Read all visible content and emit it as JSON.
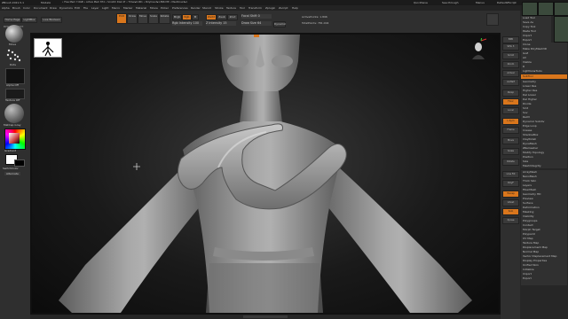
{
  "titlebar": {
    "app_title": "ZBrush 2021.5.1",
    "doc": "ModelA",
    "stats": "• Free Mem 7.6GB • Active Mem 874 • Scratch Disk 47 • Timer▸0.001 • PolyCount▸1.896 MP • MeshCount▸1",
    "quicksave": "QuickSave",
    "seethrough": "See-through",
    "menus": "Menus",
    "default_script": "DefaultZScript"
  },
  "menubar": {
    "items": [
      "Alpha",
      "Brush",
      "Color",
      "Document",
      "Draw",
      "Dynamics",
      "Edit",
      "File",
      "Layer",
      "Light",
      "Macro",
      "Marker",
      "Material",
      "Movie",
      "Picker",
      "Preferences",
      "Render",
      "Stencil",
      "Stroke",
      "Texture",
      "Tool",
      "Transform",
      "Zplugin",
      "Zscript",
      "Help"
    ]
  },
  "shelf": {
    "home_page": "Home Page",
    "lightbox": "LightBox",
    "live_boolean": "Live Boolean",
    "edit": "Edit",
    "draw": "Draw",
    "move": "Move",
    "scale": "Scale",
    "rotate": "Rotate",
    "mrgb": "Mrgb",
    "rgb": "Rgb",
    "m": "M",
    "zadd": "Zadd",
    "zsub": "Zsub",
    "zcut": "Zcut",
    "rgb_intensity": "Rgb Intensity 100",
    "z_intensity": "Z Intensity 15",
    "focal_shift": "Focal Shift 0",
    "draw_size": "Draw Size 64",
    "dynamic": "Dynamic",
    "active_points": "ActivePoints: 1.896",
    "total_points": "TotalPoints: 781.004",
    "bpr_hint": "BPR ZBR NOTE"
  },
  "left_shelf": {
    "brush_label": "Move",
    "stroke_label": "Dots",
    "alpha_label": "Alpha Off",
    "texture_label": "Texture Off",
    "material_label": "MatCap Gray",
    "gradient_label": "Gradient",
    "switch_color": "SwitchColor",
    "alternate": "Alternate"
  },
  "right_shelf": {
    "buttons": [
      "BPR",
      "SPix 3",
      "Scroll",
      "Zoom",
      "Actual",
      "AAHalf",
      "Persp",
      "Floor",
      "Local",
      "L.Sym",
      "Frame",
      "Move",
      "Scale",
      "Rotate",
      "Line Fill",
      "PolyF",
      "Transp",
      "Ghost",
      "Solo",
      "Xpose"
    ]
  },
  "tray": {
    "top": "Tool",
    "rows": [
      "Load Tool",
      "Save As",
      "Copy Tool",
      "Paste Tool",
      "Import",
      "Export",
      "Clone",
      "Make PolyMesh3D",
      "GoZ",
      "All",
      "Visible",
      "R",
      "Lightbox▸Tools",
      "SubTool",
      "Geometry",
      "Lower Res",
      "Higher Res",
      "Del Lower",
      "Del Higher",
      "Divide",
      "Smt",
      "Suv",
      "ReUV",
      "Dynamic Subdiv",
      "Edge Loop",
      "Crease",
      "ShadowBox",
      "ClayPolish",
      "DynaMesh",
      "ZRemesher",
      "Modify Topology",
      "Position",
      "Size",
      "MeshIntegrity",
      "ArrayMesh",
      "NanoMesh",
      "Thick Skin",
      "Layers",
      "FiberMesh",
      "Geometry HD",
      "Preview",
      "Surface",
      "Deformation",
      "Masking",
      "Visibility",
      "Polygroups",
      "Contact",
      "Morph Target",
      "Polypaint",
      "UV Map",
      "Texture Map",
      "Displacement Map",
      "Normal Map",
      "Vector Displacement Map",
      "Display Properties",
      "Unified Skin",
      "Initialize",
      "Import",
      "Export"
    ]
  },
  "viewport": {
    "navigator_icon": "gizmo-icon",
    "accent": "#d9761c"
  }
}
